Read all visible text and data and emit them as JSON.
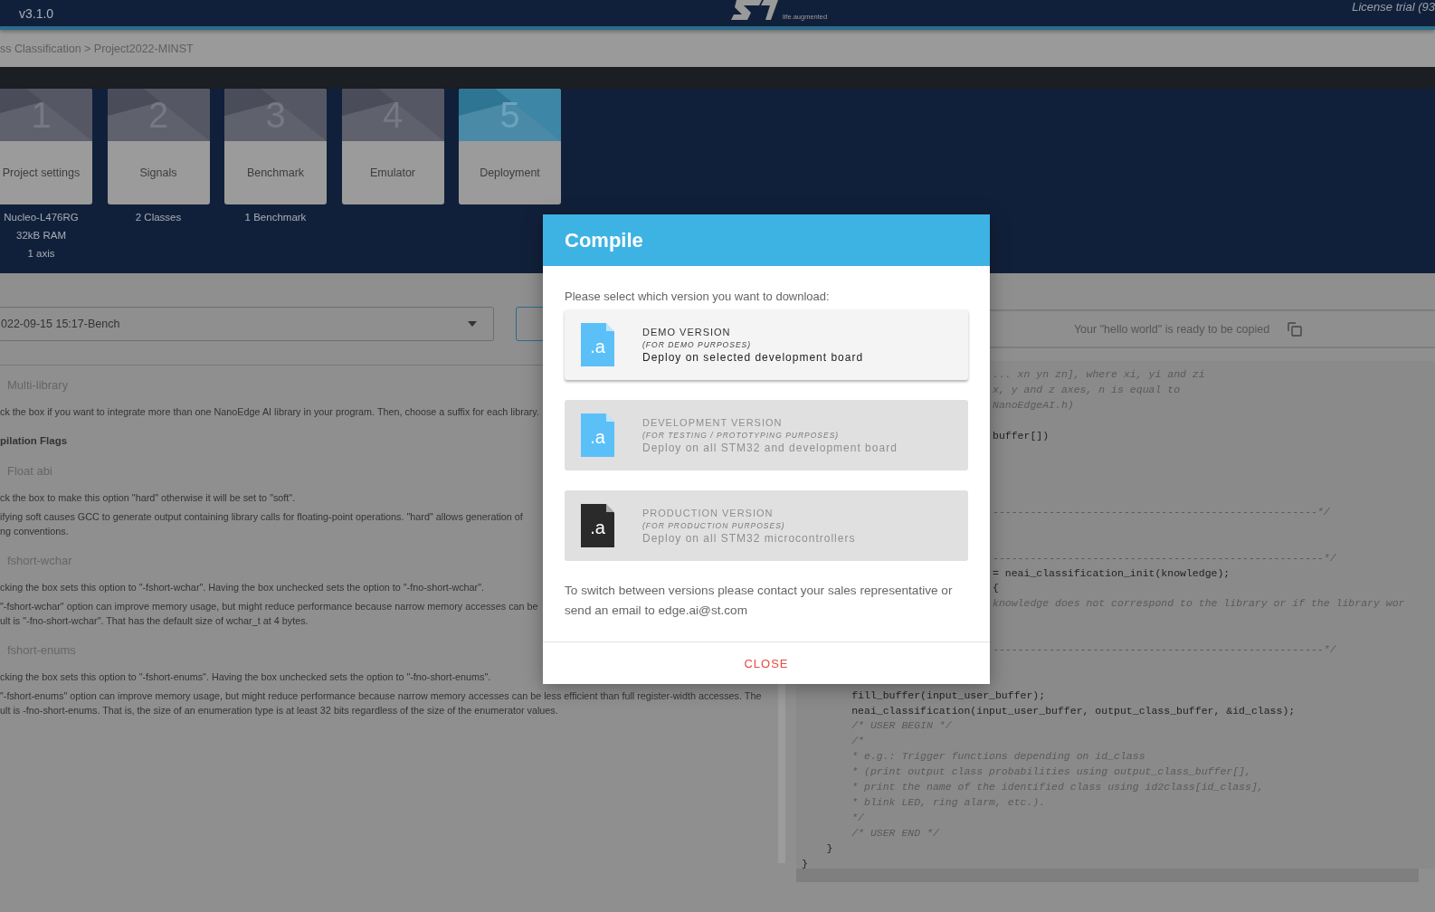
{
  "topbar": {
    "version": "v3.1.0",
    "tagline": "life.augmented",
    "license": "License trial (93"
  },
  "breadcrumb": "ss Classification > Project2022-MINST",
  "steps": [
    {
      "number": "1",
      "label": "Project settings",
      "selected": false,
      "details": [
        "Nucleo-L476RG",
        "32kB RAM",
        "1 axis"
      ]
    },
    {
      "number": "2",
      "label": "Signals",
      "selected": false,
      "details": [
        "2 Classes"
      ]
    },
    {
      "number": "3",
      "label": "Benchmark",
      "selected": false,
      "details": [
        "1 Benchmark"
      ]
    },
    {
      "number": "4",
      "label": "Emulator",
      "selected": false
    },
    {
      "number": "5",
      "label": "Deployment",
      "selected": true
    }
  ],
  "benchmark_select": {
    "value": "022-09-15 15:17-Bench"
  },
  "settings": [
    {
      "kind": "option",
      "label": "Multi-library",
      "paragraphs": [
        [
          "ck the box if you want to integrate more than one NanoEdge AI library in your program. Then, choose a suffix for each library."
        ]
      ]
    },
    {
      "kind": "heading",
      "label": "pilation Flags"
    },
    {
      "kind": "option",
      "label": "Float abi",
      "paragraphs": [
        [
          "ck the box to make this option \"hard\" otherwise it will be set to \"soft\"."
        ],
        [
          "ifying soft causes GCC to generate output containing library calls for floating-point operations. \"hard\" allows generation of",
          "ng conventions."
        ]
      ]
    },
    {
      "kind": "option",
      "label": "fshort-wchar",
      "paragraphs": [
        [
          "cking the box sets this option to \"-fshort-wchar\". Having the box unchecked sets the option to \"-fno-short-wchar\"."
        ],
        [
          "\"-fshort-wchar\" option can improve memory usage, but might reduce performance because narrow memory accesses can be",
          "ult is \"-fno-short-wchar\". That has the default size of wchar_t at 4 bytes."
        ]
      ]
    },
    {
      "kind": "option",
      "label": "fshort-enums",
      "paragraphs": [
        [
          "cking the box sets this option to \"-fshort-enums\". Having the box unchecked sets the option to \"-fno-short-enums\"."
        ],
        [
          "\"-fshort-enums\" option can improve memory usage, but might reduce performance because narrow memory accesses can be less efficient than full register-width accesses. The",
          "ult is -fno-short-enums. That is, the size of an enumeration type is at least 32 bits regardless of the size of the enumerator values."
        ]
      ]
    }
  ],
  "hello_world": {
    "message": "Your \"hello world\" is ready to be copied"
  },
  "code_lines": [
    {
      "kind": "comment",
      "text": "... xn yn zn], where xi, yi and zi"
    },
    {
      "kind": "comment",
      "text": "x, y and z axes, n is equal to"
    },
    {
      "kind": "comment",
      "text": "NanoEdgeAI.h)"
    },
    {
      "kind": "blank"
    },
    {
      "kind": "code",
      "text": "buffer[])"
    },
    {
      "kind": "blank"
    },
    {
      "kind": "blank"
    },
    {
      "kind": "blank"
    },
    {
      "kind": "blank"
    },
    {
      "kind": "comment",
      "text": "----------------------------------------------------*/"
    },
    {
      "kind": "blank"
    },
    {
      "kind": "blank"
    },
    {
      "kind": "comment",
      "text": "-----------------------------------------------------*/"
    },
    {
      "kind": "code",
      "text": "= neai_classification_init(knowledge);"
    },
    {
      "kind": "code",
      "text": "{"
    },
    {
      "kind": "comment",
      "text": "knowledge does not correspond to the library or if the library wor"
    },
    {
      "kind": "blank"
    },
    {
      "kind": "blank"
    },
    {
      "kind": "comment",
      "text": "-----------------------------------------------------*/"
    },
    {
      "kind": "blank"
    },
    {
      "kind": "blank"
    },
    {
      "kind": "code",
      "text": "        fill_buffer(input_user_buffer);"
    },
    {
      "kind": "code",
      "text": "        neai_classification(input_user_buffer, output_class_buffer, &id_class);"
    },
    {
      "kind": "comment",
      "text": "        /* USER BEGIN */"
    },
    {
      "kind": "comment",
      "text": "        /*"
    },
    {
      "kind": "comment",
      "text": "        * e.g.: Trigger functions depending on id_class"
    },
    {
      "kind": "comment",
      "text": "        * (print output class probabilities using output_class_buffer[],"
    },
    {
      "kind": "comment",
      "text": "        * print the name of the identified class using id2class[id_class],"
    },
    {
      "kind": "comment",
      "text": "        * blink LED, ring alarm, etc.)."
    },
    {
      "kind": "comment",
      "text": "        */"
    },
    {
      "kind": "comment",
      "text": "        /* USER END */"
    },
    {
      "kind": "code",
      "text": "    }"
    },
    {
      "kind": "code",
      "text": "}"
    }
  ],
  "dialog": {
    "title": "Compile",
    "prompt": "Please select which version you want to download:",
    "options": [
      {
        "title": "DEMO VERSION",
        "subtitle": "(FOR DEMO PURPOSES)",
        "description": "Deploy on selected development board",
        "icon_text": ".a",
        "color": "#5bc0f8",
        "disabled": false
      },
      {
        "title": "DEVELOPMENT VERSION",
        "subtitle": "(FOR TESTING / PROTOTYPING PURPOSES)",
        "description": "Deploy on all STM32 and development board",
        "icon_text": ".a",
        "color": "#5bc0f8",
        "disabled": true
      },
      {
        "title": "PRODUCTION VERSION",
        "subtitle": "(FOR PRODUCTION PURPOSES)",
        "description": "Deploy on all STM32 microcontrollers",
        "icon_text": ".a",
        "color": "#2a2a2a",
        "disabled": true
      }
    ],
    "note": "To switch between versions please contact your sales representative or send an email to edge.ai@st.com",
    "close": "CLOSE"
  }
}
